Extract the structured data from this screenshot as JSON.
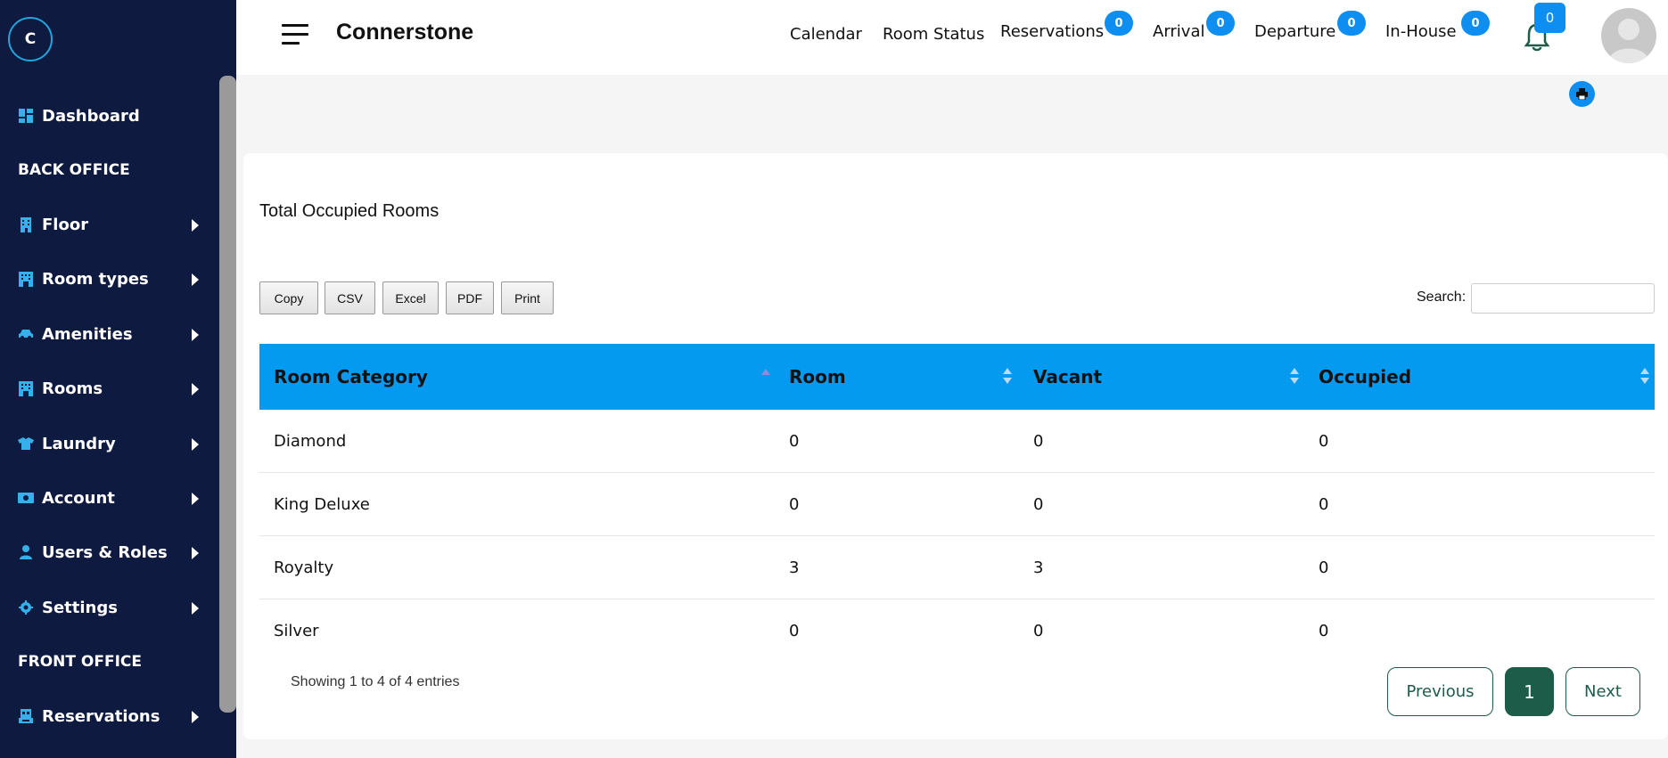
{
  "sidebar": {
    "logo_letter": "C",
    "items": [
      {
        "label": "Dashboard",
        "icon": "dashboard-icon"
      },
      {
        "label": "Floor",
        "icon": "building-icon"
      },
      {
        "label": "Room types",
        "icon": "hotel-icon"
      },
      {
        "label": "Amenities",
        "icon": "car-icon"
      },
      {
        "label": "Rooms",
        "icon": "hotel-icon"
      },
      {
        "label": "Laundry",
        "icon": "shirt-icon"
      },
      {
        "label": "Account",
        "icon": "money-icon"
      },
      {
        "label": "Users & Roles",
        "icon": "user-icon"
      },
      {
        "label": "Settings",
        "icon": "gear-icon"
      },
      {
        "label": "Reservations",
        "icon": "concierge-icon"
      }
    ],
    "sections": {
      "back_office": "BACK OFFICE",
      "front_office": "FRONT OFFICE"
    }
  },
  "header": {
    "brand": "Connerstone",
    "nav": {
      "calendar": "Calendar",
      "room_status": "Room Status",
      "reservations": "Reservations",
      "arrival": "Arrival",
      "departure": "Departure",
      "in_house": "In-House"
    },
    "badges": {
      "reservations": "0",
      "arrival": "0",
      "departure": "0",
      "in_house": "0",
      "notifications": "0"
    }
  },
  "card": {
    "title": "Total Occupied Rooms",
    "buttons": {
      "copy": "Copy",
      "csv": "CSV",
      "excel": "Excel",
      "pdf": "PDF",
      "print": "Print"
    },
    "search_label": "Search:",
    "columns": {
      "category": "Room Category",
      "room": "Room",
      "vacant": "Vacant",
      "occupied": "Occupied"
    },
    "rows": [
      {
        "category": "Diamond",
        "room": "0",
        "vacant": "0",
        "occupied": "0"
      },
      {
        "category": "King Deluxe",
        "room": "0",
        "vacant": "0",
        "occupied": "0"
      },
      {
        "category": "Royalty",
        "room": "3",
        "vacant": "3",
        "occupied": "0"
      },
      {
        "category": "Silver",
        "room": "0",
        "vacant": "0",
        "occupied": "0"
      }
    ],
    "info": "Showing 1 to 4 of 4 entries",
    "pagination": {
      "previous": "Previous",
      "current": "1",
      "next": "Next"
    }
  },
  "colors": {
    "sidebar_bg": "#0e1a40",
    "accent": "#049aef",
    "badge": "#0d8ef0",
    "pagination": "#1d5c49"
  }
}
